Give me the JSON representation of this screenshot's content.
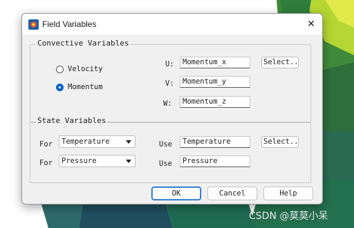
{
  "window": {
    "title": "Field Variables",
    "close_glyph": "✕",
    "app_icon": "app-logo-icon"
  },
  "convective": {
    "legend": "Convective Variables",
    "radios": [
      {
        "label": "Velocity",
        "checked": false
      },
      {
        "label": "Momentum",
        "checked": true
      }
    ],
    "fields": [
      {
        "label": "U:",
        "value": "Momentum_x"
      },
      {
        "label": "V:",
        "value": "Momentum_y"
      },
      {
        "label": "W:",
        "value": "Momentum_z"
      }
    ],
    "select_label": "Select..."
  },
  "state": {
    "legend": "State Variables",
    "rows": [
      {
        "for_label": "For",
        "selected": "Temperature",
        "use_label": "Use",
        "value": "Temperature"
      },
      {
        "for_label": "For",
        "selected": "Pressure",
        "use_label": "Use",
        "value": "Pressure"
      }
    ],
    "select_label": "Select..."
  },
  "buttons": {
    "ok": "OK",
    "cancel": "Cancel",
    "help": "Help"
  },
  "watermark": "CSDN @莫莫小呆",
  "colors": {
    "accent": "#0a64c8",
    "dialog_bg": "#f0f0f0"
  }
}
